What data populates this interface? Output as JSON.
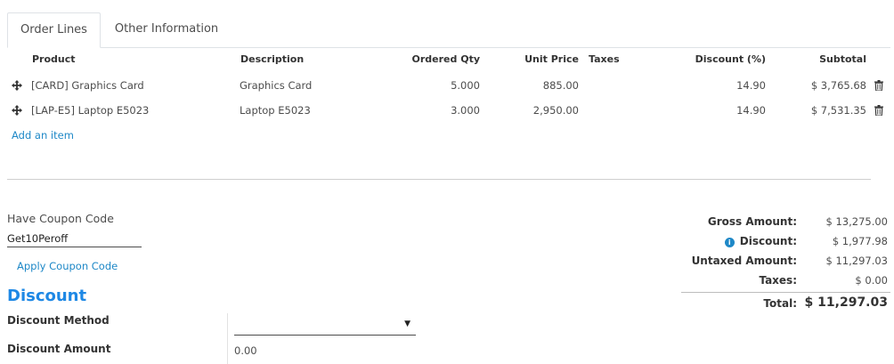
{
  "tabs": [
    {
      "label": "Order Lines"
    },
    {
      "label": "Other Information"
    }
  ],
  "table": {
    "columns": [
      "Product",
      "Description",
      "Ordered Qty",
      "Unit Price",
      "Taxes",
      "Discount (%)",
      "Subtotal"
    ],
    "rows": [
      {
        "product": "[CARD] Graphics Card",
        "description": "Graphics Card",
        "qty": "5.000",
        "price": "885.00",
        "taxes": "",
        "discount": "14.90",
        "subtotal": "$ 3,765.68"
      },
      {
        "product": "[LAP-E5] Laptop E5023",
        "description": "Laptop E5023",
        "qty": "3.000",
        "price": "2,950.00",
        "taxes": "",
        "discount": "14.90",
        "subtotal": "$ 7,531.35"
      }
    ],
    "add_item": "Add an item"
  },
  "coupon": {
    "label": "Have Coupon Code",
    "value": "Get10Peroff",
    "apply_label": "Apply Coupon Code"
  },
  "discount_section": {
    "title": "Discount",
    "method_label": "Discount Method",
    "method_value": "",
    "amount_label": "Discount Amount",
    "amount_value": "0.00"
  },
  "totals": {
    "gross_label": "Gross Amount:",
    "gross_value": "$ 13,275.00",
    "discount_label": "Discount:",
    "discount_value": "$ 1,977.98",
    "untaxed_label": "Untaxed Amount:",
    "untaxed_value": "$ 11,297.03",
    "taxes_label": "Taxes:",
    "taxes_value": "$ 0.00",
    "total_label": "Total:",
    "total_value": "$ 11,297.03"
  },
  "colors": {
    "link": "#1e88c7",
    "accent": "#1e88e5"
  },
  "icons": {
    "row_handle": "drag-handle-icon",
    "row_delete": "trash-icon",
    "discount_info": "info-icon"
  }
}
